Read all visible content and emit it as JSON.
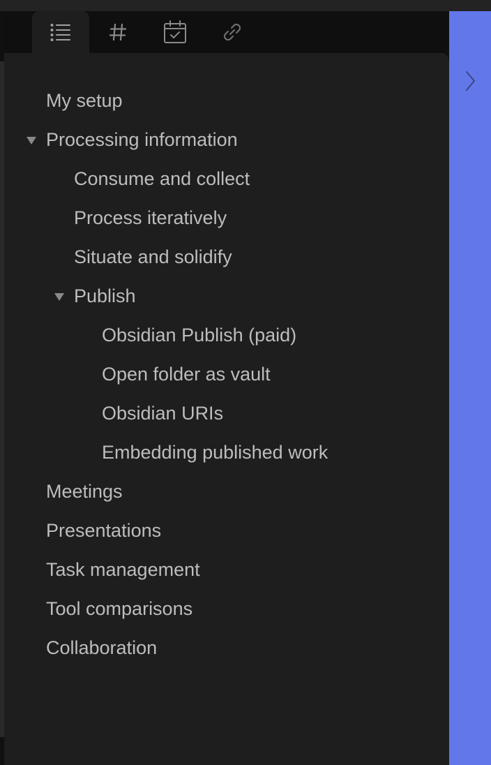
{
  "tabs": [
    {
      "icon": "list-icon",
      "active": true
    },
    {
      "icon": "hash-icon",
      "active": false
    },
    {
      "icon": "calendar-check-icon",
      "active": false
    },
    {
      "icon": "link-icon",
      "active": false
    }
  ],
  "outline": {
    "items": [
      {
        "label": "My setup",
        "level": 0
      },
      {
        "label": "Processing information",
        "level": 0,
        "expanded": true
      },
      {
        "label": "Consume and collect",
        "level": 1
      },
      {
        "label": "Process iteratively",
        "level": 1
      },
      {
        "label": "Situate and solidify",
        "level": 1
      },
      {
        "label": "Publish",
        "level": 1,
        "expanded": true
      },
      {
        "label": "Obsidian Publish (paid)",
        "level": 2
      },
      {
        "label": "Open folder as vault",
        "level": 2
      },
      {
        "label": "Obsidian URIs",
        "level": 2
      },
      {
        "label": "Embedding published work",
        "level": 2
      },
      {
        "label": "Meetings",
        "level": 0
      },
      {
        "label": "Presentations",
        "level": 0
      },
      {
        "label": "Task management",
        "level": 0
      },
      {
        "label": "Tool comparisons",
        "level": 0
      },
      {
        "label": "Collaboration",
        "level": 0
      }
    ]
  },
  "colors": {
    "accent": "#6277ea",
    "panel": "#1e1e1e",
    "text": "#bdbdbd"
  },
  "right_pane": {
    "collapse_icon": "chevron-right-icon"
  }
}
